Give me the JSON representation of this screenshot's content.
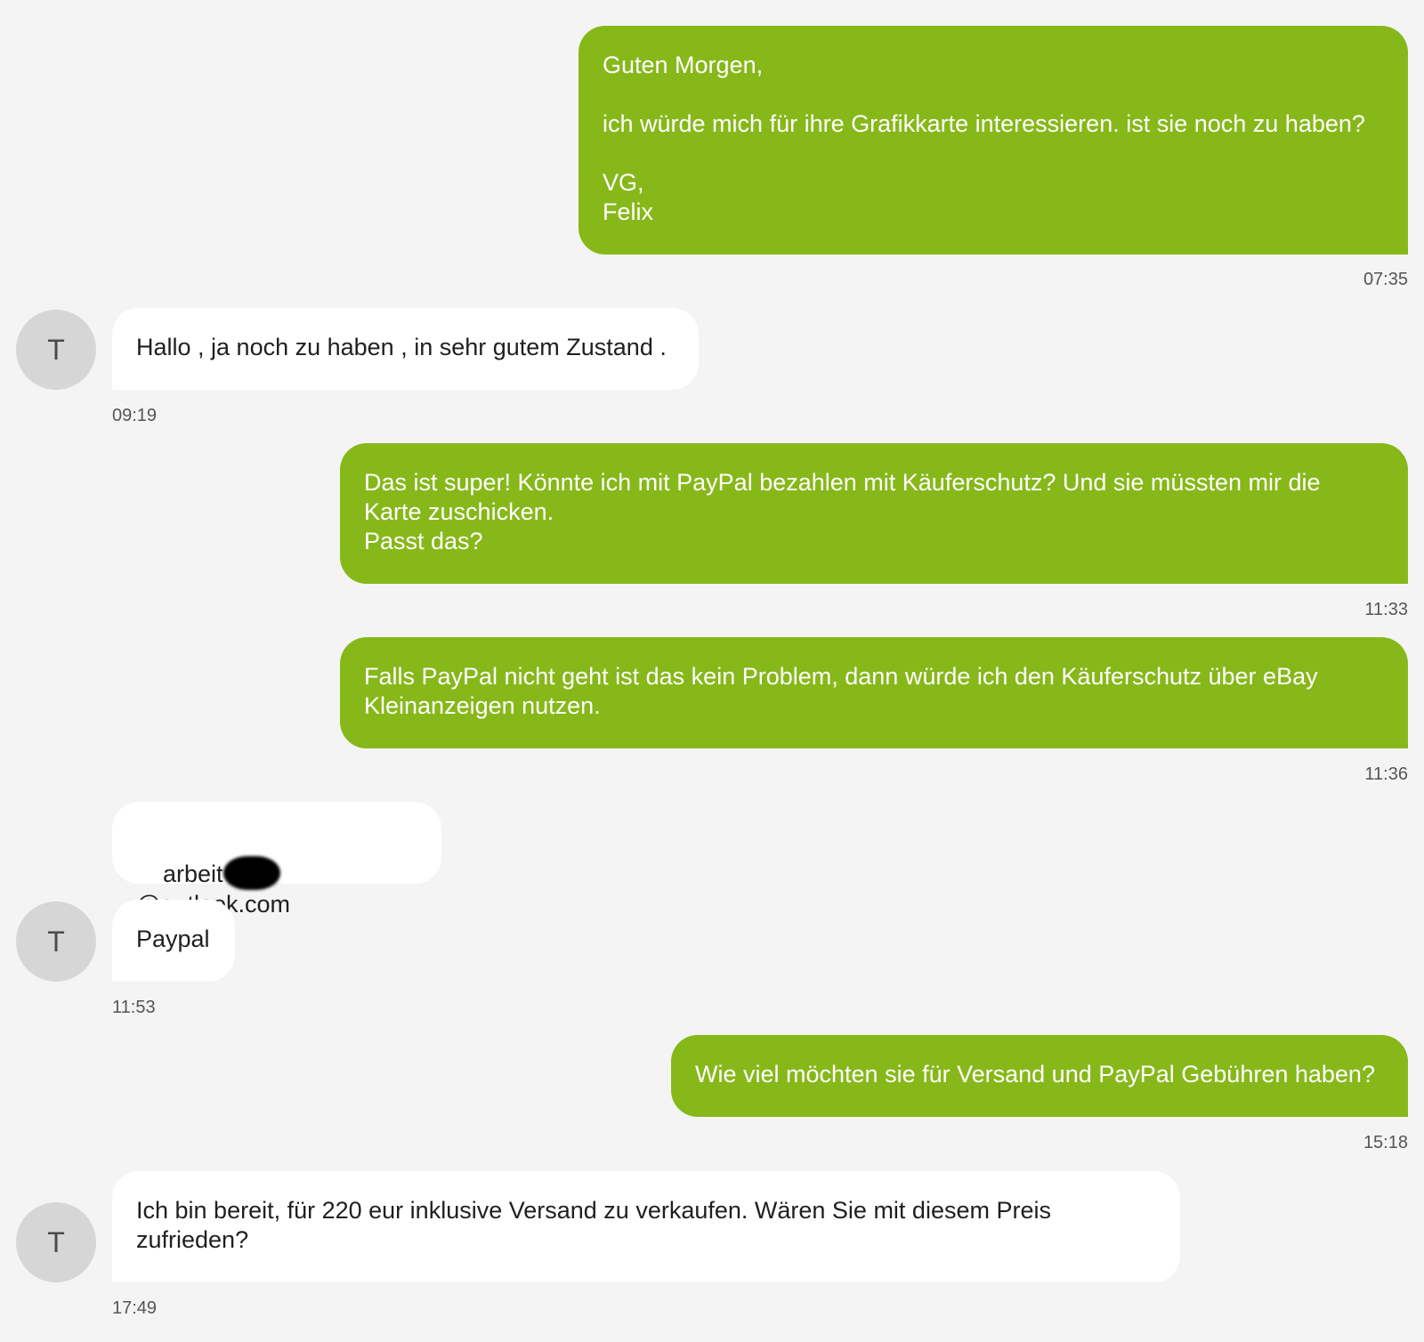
{
  "contact": {
    "avatar_initial": "T"
  },
  "messages": [
    {
      "direction": "out",
      "text": "Guten Morgen,\n\nich würde mich für ihre Grafikkarte interessieren. ist sie noch zu haben?\n\nVG,\nFelix",
      "time": "07:35"
    },
    {
      "direction": "in",
      "text": "Hallo , ja noch zu haben , in sehr gutem Zustand .",
      "time": "09:19"
    },
    {
      "direction": "out",
      "text": "Das ist super! Könnte ich mit PayPal bezahlen mit Käuferschutz? Und sie müssten mir die Karte zuschicken.\nPasst das?",
      "time": "11:33"
    },
    {
      "direction": "out",
      "text": "Falls PayPal nicht geht ist das kein Problem, dann würde ich den Käuferschutz über eBay Kleinanzeigen nutzen.",
      "time": "11:36"
    },
    {
      "direction": "in",
      "text_prefix": "arbeit",
      "text_suffix": "@outlook.com",
      "redacted": true
    },
    {
      "direction": "in",
      "text": "Paypal",
      "time": "11:53"
    },
    {
      "direction": "out",
      "text": "Wie viel möchten sie für Versand und PayPal Gebühren haben?",
      "time": "15:18"
    },
    {
      "direction": "in",
      "text": "Ich bin bereit, für 220 eur inklusive Versand zu verkaufen. Wären Sie mit diesem Preis zufrieden?",
      "time": "17:49"
    }
  ],
  "colors": {
    "background": "#f4f4f4",
    "outgoing_bubble": "#86b81a",
    "incoming_bubble": "#ffffff",
    "avatar": "#d6d6d6"
  }
}
